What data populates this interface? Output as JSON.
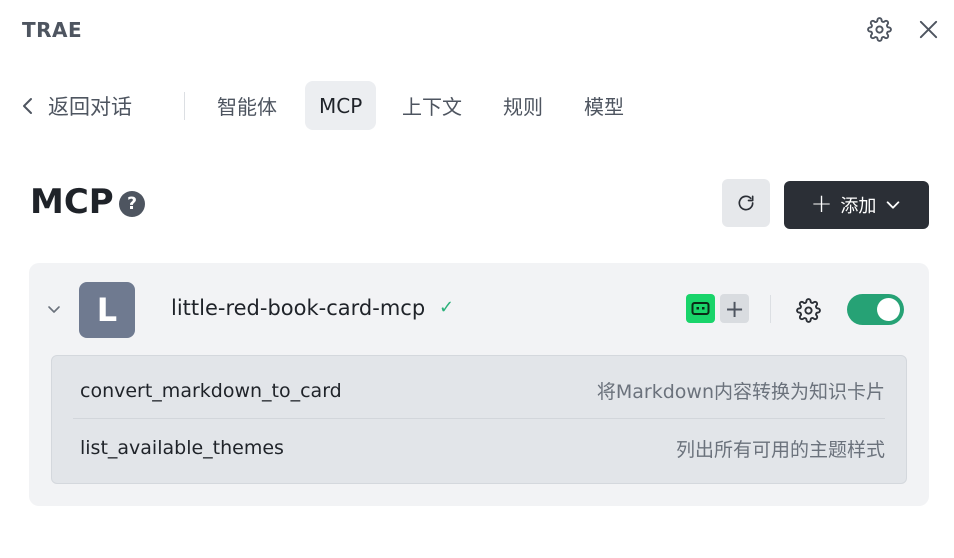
{
  "app": {
    "title": "TRAE"
  },
  "nav": {
    "back_label": "返回对话",
    "tabs": [
      {
        "label": "智能体",
        "active": false
      },
      {
        "label": "MCP",
        "active": true
      },
      {
        "label": "上下文",
        "active": false
      },
      {
        "label": "规则",
        "active": false
      },
      {
        "label": "模型",
        "active": false
      }
    ]
  },
  "section": {
    "title": "MCP",
    "help_glyph": "?",
    "add_label": "添加"
  },
  "servers": [
    {
      "avatar_letter": "L",
      "name": "little-red-book-card-mcp",
      "status": "✓",
      "enabled": true,
      "tools": [
        {
          "name": "convert_markdown_to_card",
          "description": "将Markdown内容转换为知识卡片"
        },
        {
          "name": "list_available_themes",
          "description": "列出所有可用的主题样式"
        }
      ]
    }
  ],
  "icons": {
    "settings": "gear-icon",
    "close": "close-icon",
    "back": "chevron-left-icon",
    "refresh": "refresh-icon",
    "add": "plus-icon",
    "dropdown": "chevron-down-icon",
    "expand": "chevron-down-icon",
    "agent_tag": "bot-icon"
  },
  "colors": {
    "accent_dark": "#2b2f36",
    "toggle_on": "#26a275",
    "status_ok": "#2bb07a",
    "bot_tag": "#19d46a"
  }
}
